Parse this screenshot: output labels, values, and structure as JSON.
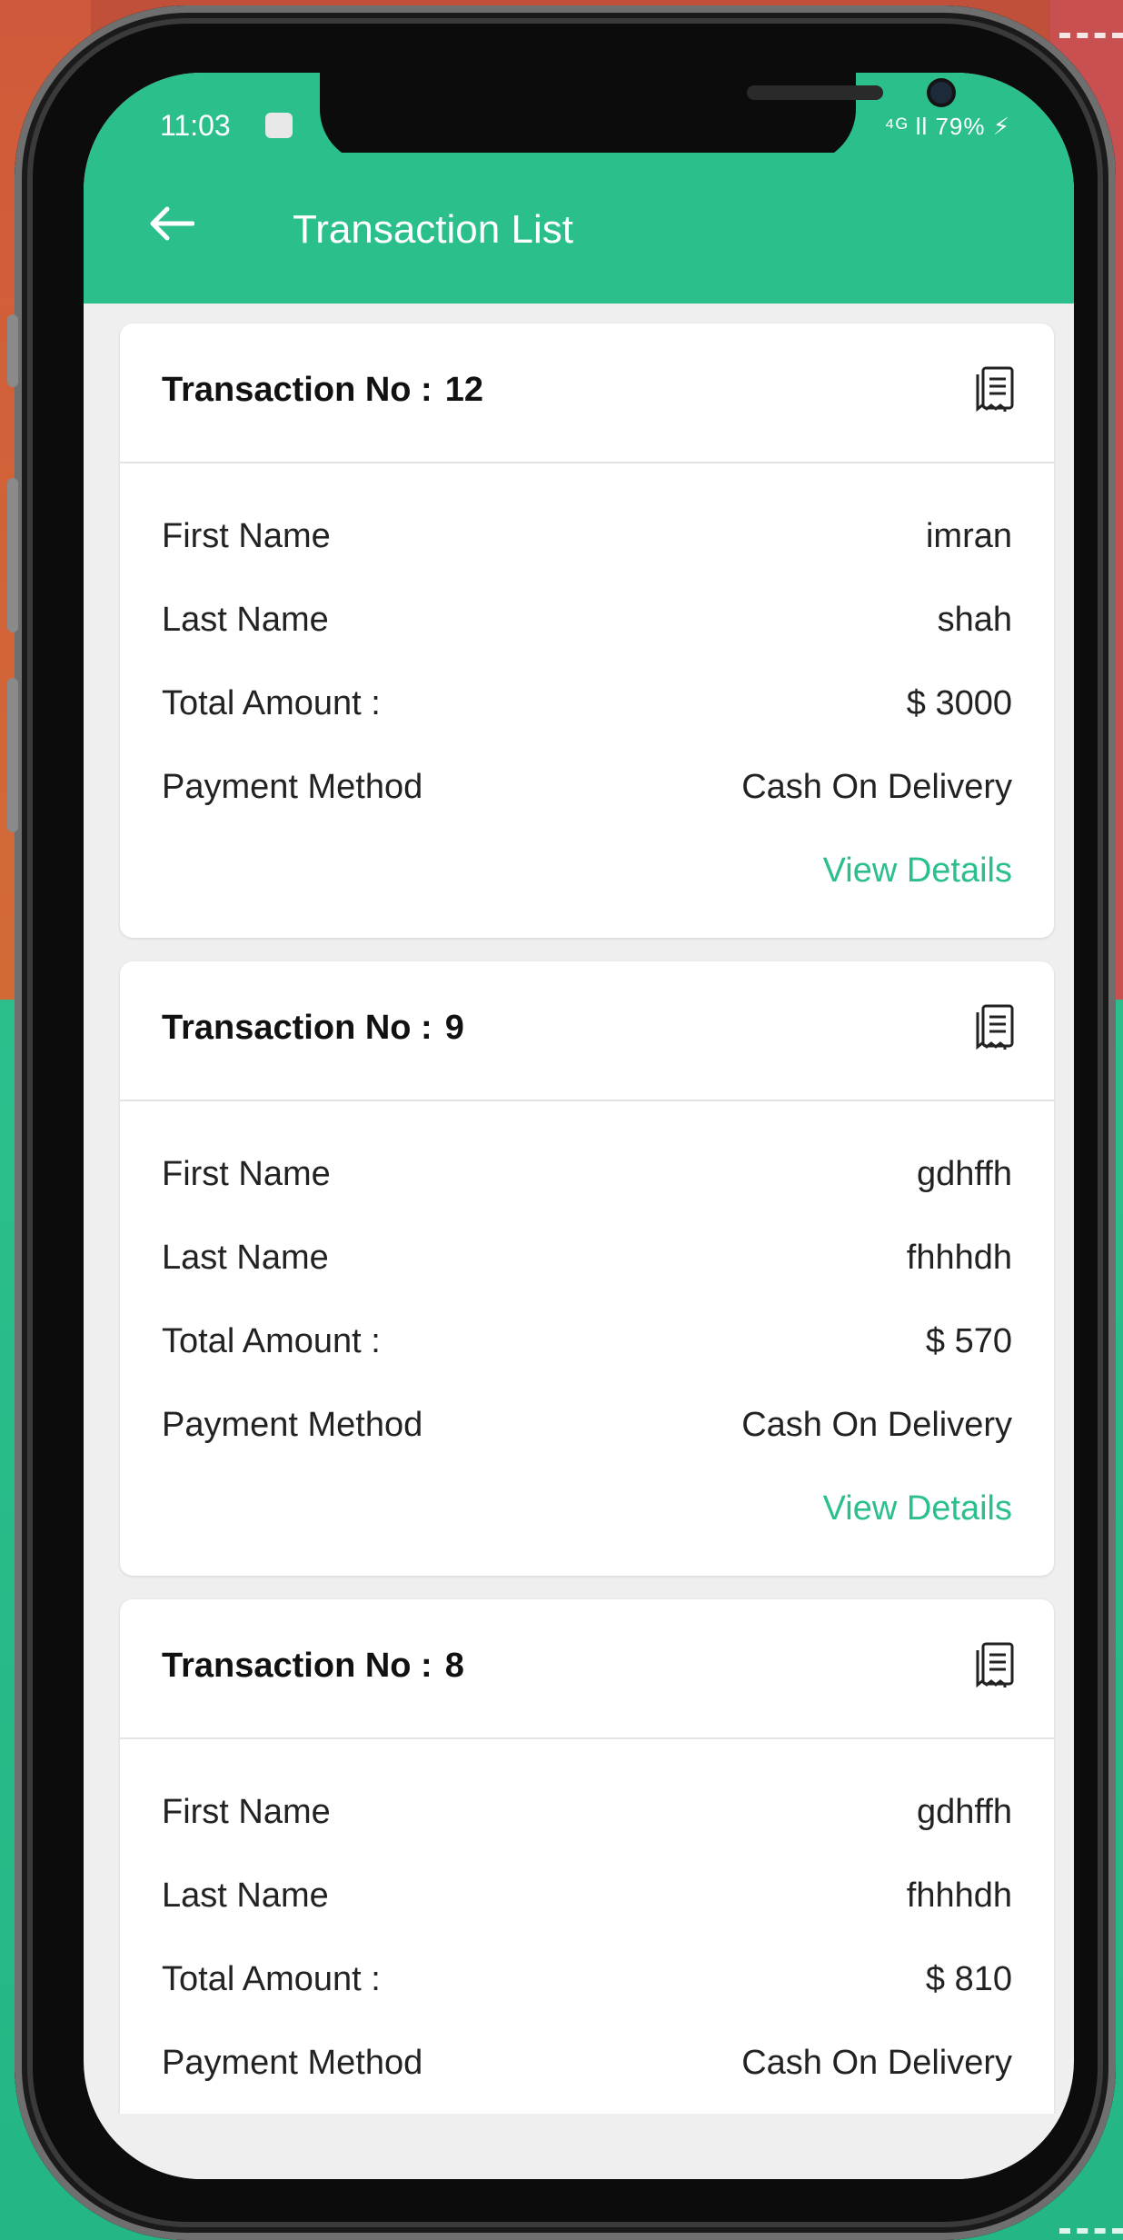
{
  "status_bar": {
    "time": "11:03",
    "right_text": "⁴ᴳ ll 79% ⚡",
    "battery": "79%"
  },
  "app_bar": {
    "title": "Transaction List",
    "back_icon": "arrow-left-icon"
  },
  "labels": {
    "transaction_no": "Transaction No :",
    "first_name": "First Name",
    "last_name": "Last Name",
    "total_amount": "Total Amount :",
    "payment_method": "Payment Method",
    "view_details": "View Details"
  },
  "transactions": [
    {
      "number": "12",
      "first_name": "imran",
      "last_name": "shah",
      "total_amount": "$ 3000",
      "payment_method": "Cash On Delivery"
    },
    {
      "number": "9",
      "first_name": "gdhffh",
      "last_name": "fhhhdh",
      "total_amount": "$ 570",
      "payment_method": "Cash On Delivery"
    },
    {
      "number": "8",
      "first_name": "gdhffh",
      "last_name": "fhhhdh",
      "total_amount": "$ 810",
      "payment_method": "Cash On Delivery"
    }
  ],
  "colors": {
    "accent": "#2bbf8c",
    "background": "#efefef"
  }
}
